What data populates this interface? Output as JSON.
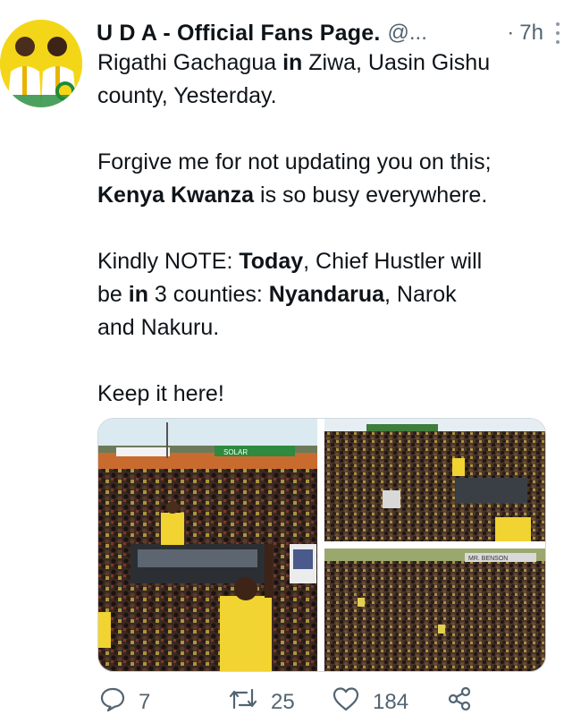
{
  "tweet": {
    "author_name": "U D A - Official Fans Page.",
    "handle": "@...",
    "separator": "·",
    "time": "7h",
    "lines": {
      "l1a": "Rigathi Gachagua ",
      "l1b": "in",
      "l1c": " Ziwa, Uasin Gishu",
      "l2": "county, Yesterday.",
      "l3": "Forgive me for not updating you on this;",
      "l4a": "Kenya Kwanza",
      "l4b": " is so busy everywhere.",
      "l5a": "Kindly NOTE: ",
      "l5b": "Today",
      "l5c": ", Chief Hustler will",
      "l6a": "be ",
      "l6b": "in",
      "l6c": " 3 counties: ",
      "l6d": "Nyandarua",
      "l6e": ", Narok",
      "l7": "and Nakuru.",
      "l8": "Keep it here!"
    },
    "photo_texts": {
      "sign_left": "SOLAR",
      "sign_right": "MR. BENSON"
    },
    "actions": {
      "replies": "7",
      "retweets": "25",
      "likes": "184"
    }
  },
  "colors": {
    "muted": "#536471",
    "border": "#cfd9de",
    "avatar_bg": "#f2d21b"
  },
  "icons": [
    "reply-icon",
    "retweet-icon",
    "like-icon",
    "share-icon",
    "more-icon"
  ]
}
